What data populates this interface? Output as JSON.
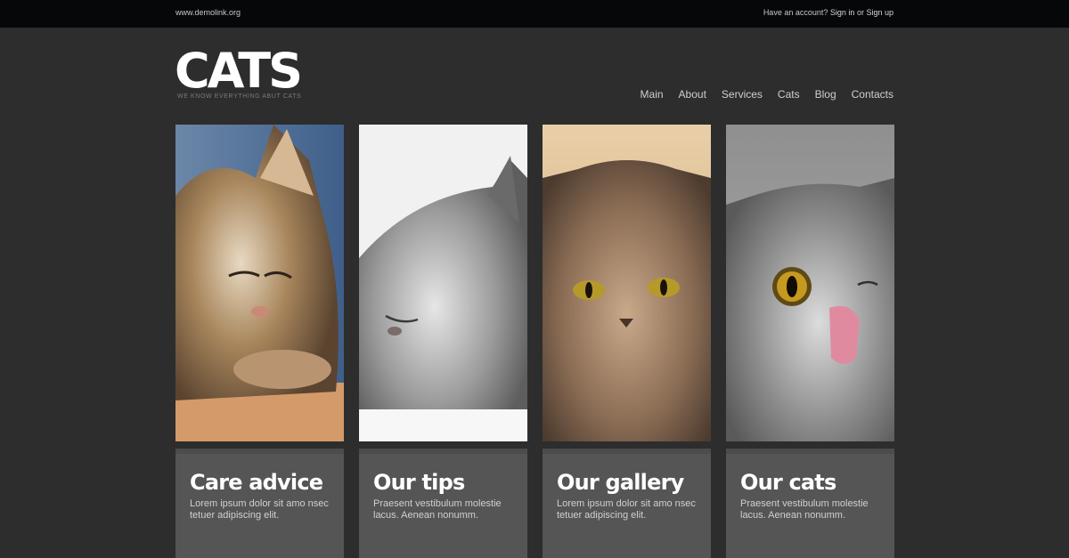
{
  "topbar": {
    "url": "www.demolink.org",
    "account_text": "Have an account?",
    "sign_in": "Sign in",
    "or": "or",
    "sign_up": "Sign up"
  },
  "header": {
    "logo": "CATS",
    "tagline": "WE KNOW EVERYTHING ABUT CATS"
  },
  "nav": {
    "items": [
      "Main",
      "About",
      "Services",
      "Cats",
      "Blog",
      "Contacts"
    ]
  },
  "photos": [
    {
      "alt": "sleeping tabby kitten"
    },
    {
      "alt": "sleeping grey fluffy kitten"
    },
    {
      "alt": "grumpy persian cat"
    },
    {
      "alt": "grey cat licking nose"
    }
  ],
  "cards": [
    {
      "title": "Care advice",
      "text": "Lorem ipsum dolor sit amo nsec tetuer adipiscing elit."
    },
    {
      "title": "Our tips",
      "text": "Praesent vestibulum molestie lacus. Aenean nonumm."
    },
    {
      "title": "Our gallery",
      "text": "Lorem ipsum dolor sit amo nsec tetuer adipiscing elit."
    },
    {
      "title": "Our cats",
      "text": "Praesent vestibulum molestie lacus. Aenean nonumm."
    }
  ]
}
